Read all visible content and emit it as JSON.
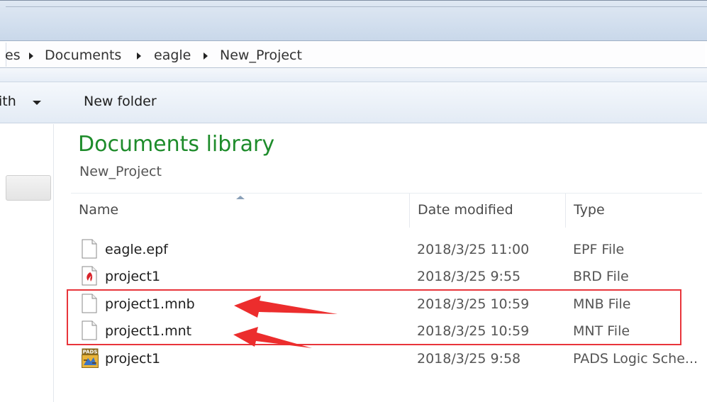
{
  "breadcrumb": {
    "items": [
      "es",
      "Documents",
      "eagle",
      "New_Project"
    ]
  },
  "toolbar": {
    "open_with_label": "ith",
    "new_folder_label": "New folder"
  },
  "library": {
    "title": "Documents library",
    "subtitle": "New_Project"
  },
  "columns": {
    "name": "Name",
    "date_modified": "Date modified",
    "type": "Type"
  },
  "files": [
    {
      "name": "eagle.epf",
      "date": "2018/3/25 11:00",
      "type": "EPF File",
      "icon": "generic-file-icon"
    },
    {
      "name": "project1",
      "date": "2018/3/25 9:55",
      "type": "BRD File",
      "icon": "eagle-brd-file-icon"
    },
    {
      "name": "project1.mnb",
      "date": "2018/3/25 10:59",
      "type": "MNB File",
      "icon": "generic-file-icon"
    },
    {
      "name": "project1.mnt",
      "date": "2018/3/25 10:59",
      "type": "MNT File",
      "icon": "generic-file-icon"
    },
    {
      "name": "project1",
      "date": "2018/3/25 9:58",
      "type": "PADS Logic Sche...",
      "icon": "pads-logic-file-icon"
    }
  ],
  "pads_icon_text": "PADS",
  "colors": {
    "library_title": "#1e8c2b",
    "annotation": "#e8353b"
  }
}
